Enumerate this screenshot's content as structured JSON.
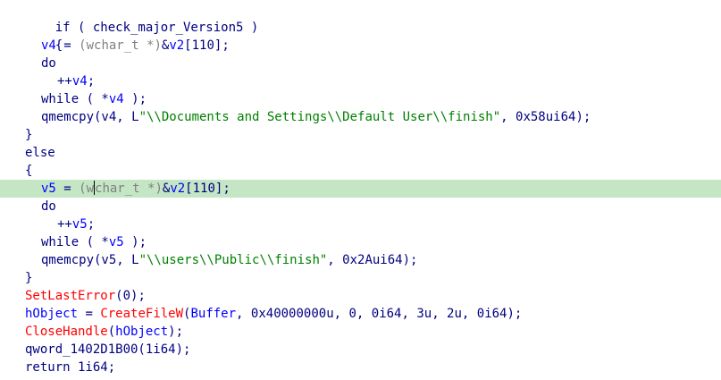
{
  "code": {
    "l1": [
      "if ( check_major_Version5 )"
    ],
    "l2": [
      "{"
    ],
    "l3": [
      "v4",
      " = ",
      "(wchar_t *)",
      "&",
      "v2",
      "[110];"
    ],
    "l4": [
      "do"
    ],
    "l5": [
      "++",
      "v4",
      ";"
    ],
    "l6": [
      "while ( *",
      "v4",
      " );"
    ],
    "l7": [
      "qmemcpy(v4, L",
      "\"\\\\Documents and Settings\\\\Default User\\\\finish\"",
      ", 0x58ui64);"
    ],
    "l8": [
      "}"
    ],
    "l9": [
      "else"
    ],
    "l10": [
      "{"
    ],
    "l11": [
      "v5",
      " = ",
      "(w",
      "char_t *)",
      "&",
      "v2",
      "[110];"
    ],
    "l12": [
      "do"
    ],
    "l13": [
      "++",
      "v5",
      ";"
    ],
    "l14": [
      "while ( *",
      "v5",
      " );"
    ],
    "l15": [
      "qmemcpy(v5, L",
      "\"\\\\users\\\\Public\\\\finish\"",
      ", 0x2Aui64);"
    ],
    "l16": [
      "}"
    ],
    "l17": [
      "SetLastError",
      "(0);"
    ],
    "l18": [
      "hObject",
      " = ",
      "CreateFileW",
      "(",
      "Buffer",
      ", 0x40000000u, 0, 0i64, 3u, 2u, 0i64);"
    ],
    "l19": [
      "CloseHandle",
      "(",
      "hObject",
      ");"
    ],
    "l20": [
      "qword_1402D1B00(1i64);"
    ],
    "l21": [
      "return 1i64;"
    ]
  }
}
